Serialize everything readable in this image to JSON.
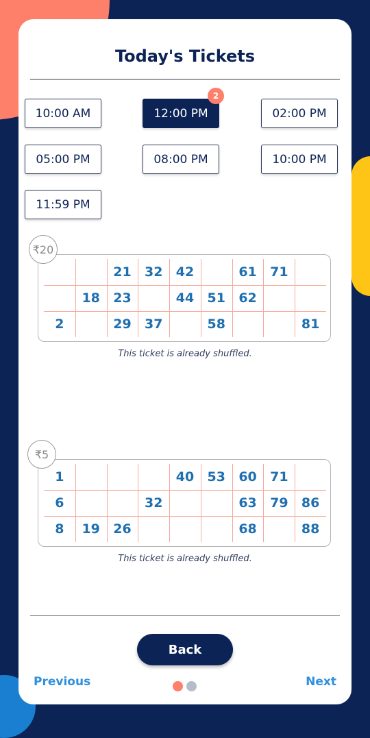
{
  "title": "Today's Tickets",
  "colors": {
    "navy": "#0c2355",
    "accent": "#fe7f6a",
    "number": "#1f6fb0",
    "link": "#2f8fdd",
    "yellow": "#fec516"
  },
  "time_slots": [
    {
      "label": "10:00 AM",
      "active": false
    },
    {
      "label": "12:00 PM",
      "active": true,
      "badge": "2"
    },
    {
      "label": "02:00 PM",
      "active": false
    },
    {
      "label": "05:00 PM",
      "active": false
    },
    {
      "label": "08:00 PM",
      "active": false
    },
    {
      "label": "10:00 PM",
      "active": false
    },
    {
      "label": "11:59 PM",
      "active": false
    }
  ],
  "tickets": [
    {
      "price": "₹20",
      "rows": [
        [
          "",
          "",
          "21",
          "32",
          "42",
          "",
          "61",
          "71",
          ""
        ],
        [
          "",
          "18",
          "23",
          "",
          "44",
          "51",
          "62",
          "",
          ""
        ],
        [
          "2",
          "",
          "29",
          "37",
          "",
          "58",
          "",
          "",
          "81"
        ]
      ],
      "note": "This ticket is already shuffled."
    },
    {
      "price": "₹5",
      "rows": [
        [
          "1",
          "",
          "",
          "",
          "40",
          "53",
          "60",
          "71",
          ""
        ],
        [
          "6",
          "",
          "",
          "32",
          "",
          "",
          "63",
          "79",
          "86"
        ],
        [
          "8",
          "19",
          "26",
          "",
          "",
          "",
          "68",
          "",
          "88"
        ]
      ],
      "note": "This ticket is already shuffled."
    }
  ],
  "footer": {
    "back_label": "Back",
    "previous_label": "Previous",
    "next_label": "Next",
    "pages": 2,
    "current_page": 1
  }
}
